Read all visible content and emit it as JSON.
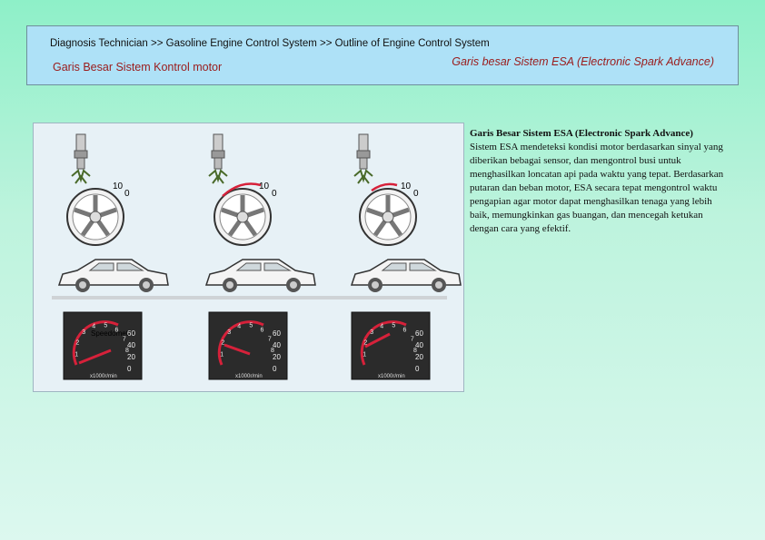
{
  "header": {
    "breadcrumb": "Diagnosis Technician >> Gasoline Engine Control System >> Outline of Engine Control System",
    "left_title": "Garis Besar Sistem Kontrol motor",
    "right_title": "Garis besar Sistem ESA (Electronic Spark Advance)"
  },
  "figure": {
    "wheel_label_10": "10",
    "wheel_label_0": "0",
    "speedometer_label": "Speedometer",
    "gauge_ticks": [
      "1",
      "2",
      "3",
      "4",
      "5",
      "6",
      "7",
      "8"
    ],
    "gauge_right_ticks": [
      "60",
      "40",
      "20",
      "0"
    ],
    "gauge_unit": "x1000r/min"
  },
  "description": {
    "title": "Garis Besar Sistem ESA (Electronic Spark Advance)",
    "body": "Sistem ESA mendeteksi kondisi motor berdasarkan sinyal yang diberikan bebagai sensor, dan mengontrol busi untuk menghasilkan loncatan api pada waktu yang tepat. Berdasarkan putaran dan beban motor, ESA secara tepat mengontrol waktu pengapian agar motor dapat menghasilkan tenaga yang lebih baik, memungkinkan gas buangan, dan mencegah ketukan dengan cara yang efektif."
  },
  "colors": {
    "accent_red": "#d6213a",
    "header_bg": "#aee1f7"
  }
}
